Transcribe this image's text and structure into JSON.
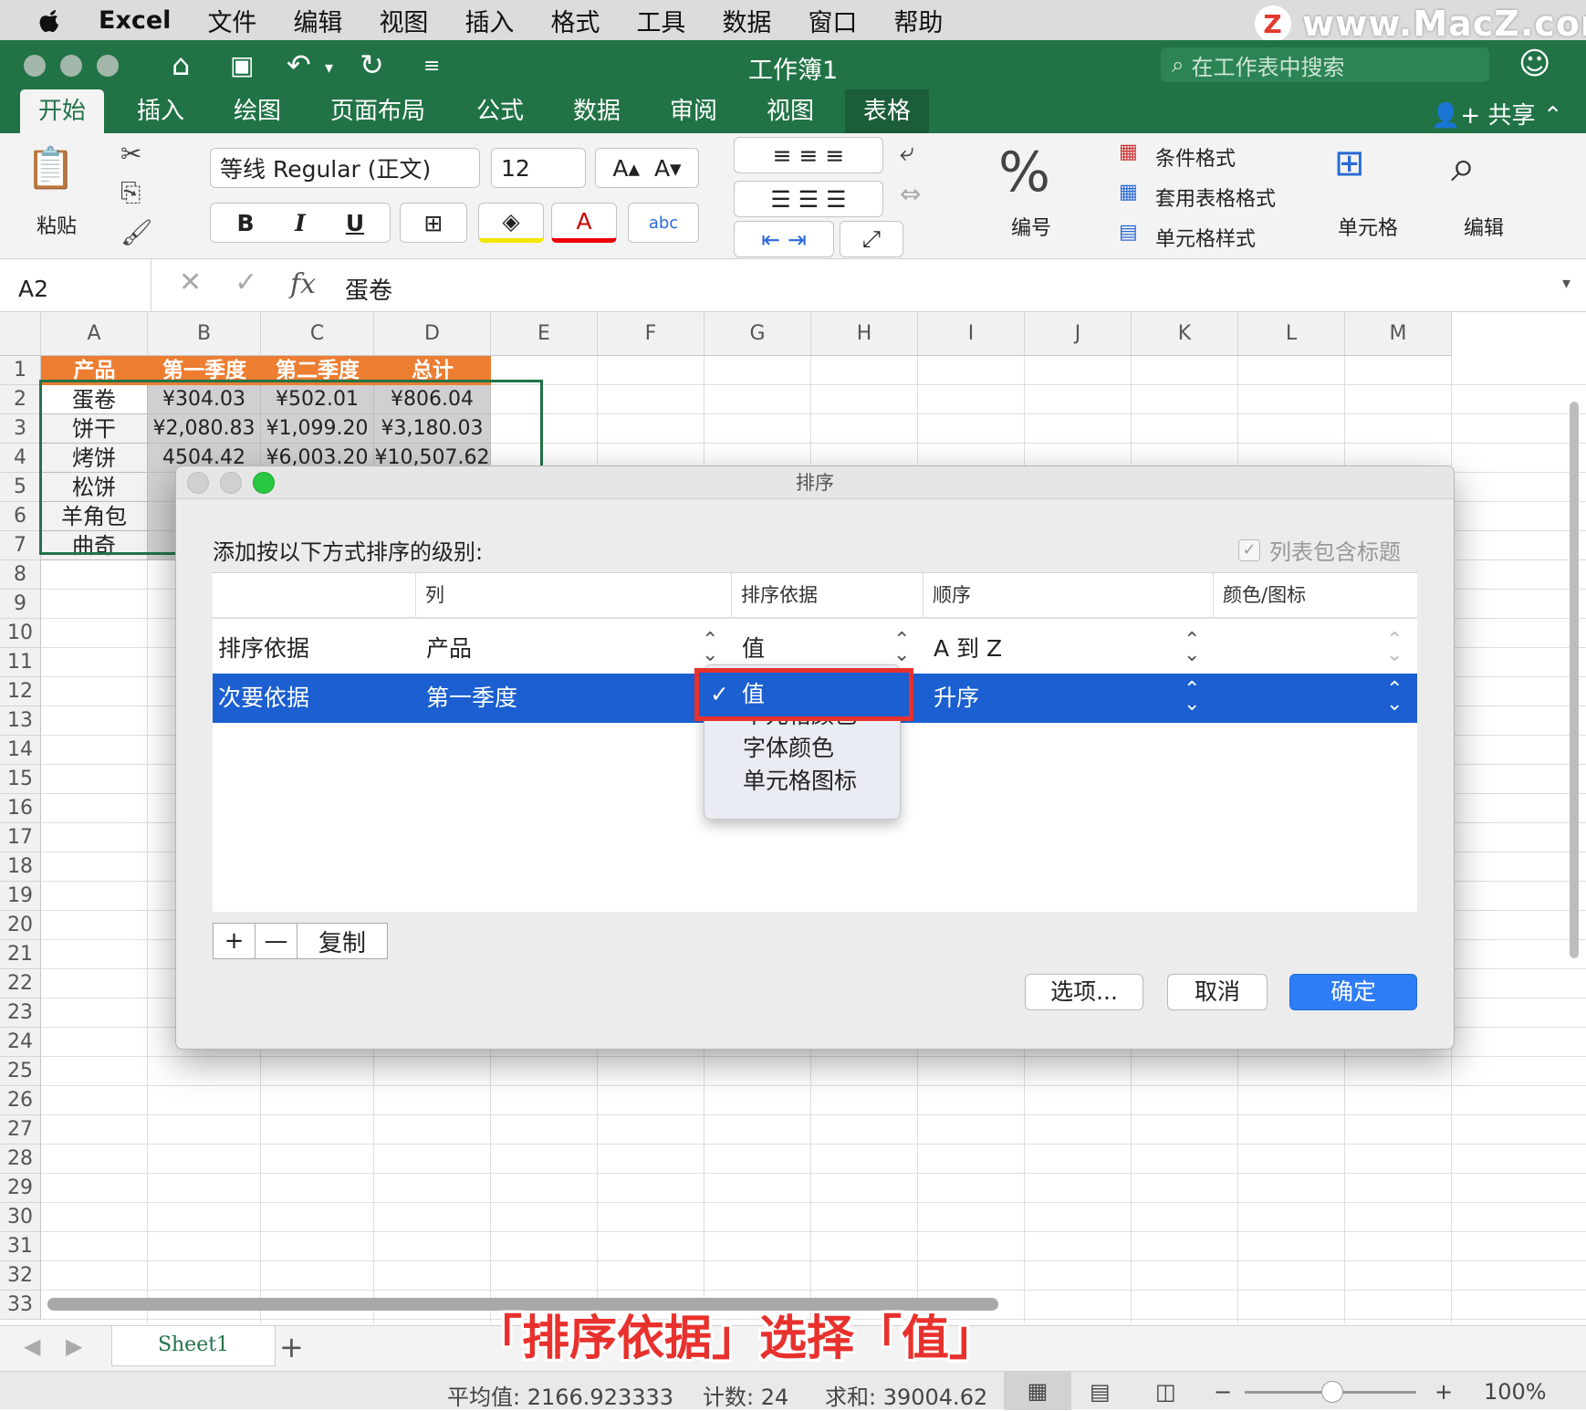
{
  "menubar": {
    "app": "Excel",
    "items": [
      "文件",
      "编辑",
      "视图",
      "插入",
      "格式",
      "工具",
      "数据",
      "窗口",
      "帮助"
    ]
  },
  "watermark": "www.MacZ.com",
  "titlebar": {
    "title": "工作簿1",
    "search_placeholder": "在工作表中搜索"
  },
  "tabs": [
    "开始",
    "插入",
    "绘图",
    "页面布局",
    "公式",
    "数据",
    "审阅",
    "视图",
    "表格"
  ],
  "share": "共享",
  "ribbon": {
    "paste": "粘贴",
    "font_name": "等线 Regular (正文)",
    "font_size": "12",
    "bold": "B",
    "italic": "I",
    "underline": "U",
    "number_label": "编号",
    "cond_format": "条件格式",
    "table_format": "套用表格格式",
    "cell_styles": "单元格样式",
    "cells_label": "单元格",
    "edit_label": "编辑"
  },
  "formula": {
    "name_box": "A2",
    "fx": "fx",
    "value": "蛋卷"
  },
  "grid": {
    "columns": [
      "A",
      "B",
      "C",
      "D",
      "E",
      "F",
      "G",
      "H",
      "I",
      "J",
      "K",
      "L",
      "M"
    ],
    "rows": [
      "1",
      "2",
      "3",
      "4",
      "5",
      "6",
      "7",
      "8",
      "9",
      "10",
      "11",
      "12",
      "13",
      "14",
      "15",
      "16",
      "17",
      "18",
      "19",
      "20",
      "21",
      "22",
      "23",
      "24",
      "25",
      "26",
      "27",
      "28",
      "29",
      "30",
      "31",
      "32",
      "33"
    ],
    "header": [
      "产品",
      "第一季度",
      "第二季度",
      "总计"
    ],
    "data": [
      [
        "蛋卷",
        "¥304.03",
        "¥502.01",
        "¥806.04"
      ],
      [
        "饼干",
        "¥2,080.83",
        "¥1,099.20",
        "¥3,180.03"
      ],
      [
        "烤饼",
        "4504.42",
        "¥6,003.20",
        "¥10,507.62"
      ],
      [
        "松饼",
        "",
        "",
        ""
      ],
      [
        "羊角包",
        "",
        "",
        ""
      ],
      [
        "曲奇",
        "",
        "",
        ""
      ]
    ]
  },
  "sheet": {
    "name": "Sheet1",
    "add": "+"
  },
  "caption": "「排序依据」选择「值」",
  "status": {
    "average": "平均值: 2166.923333",
    "count": "计数: 24",
    "sum": "求和: 39004.62",
    "zoom": "100%"
  },
  "dialog": {
    "title": "排序",
    "prompt": "添加按以下方式排序的级别:",
    "has_header": "列表包含标题",
    "columns": [
      "列",
      "排序依据",
      "顺序",
      "颜色/图标"
    ],
    "rows": [
      {
        "level": "排序依据",
        "column": "产品",
        "sort_on": "值",
        "order": "A 到 Z",
        "color": ""
      },
      {
        "level": "次要依据",
        "column": "第一季度",
        "sort_on": "值",
        "order": "升序",
        "color": ""
      }
    ],
    "popup": {
      "checked": "值",
      "items": [
        "值",
        "单元格颜色",
        "字体颜色",
        "单元格图标"
      ]
    },
    "add": "+",
    "remove": "—",
    "copy": "复制",
    "options": "选项...",
    "cancel": "取消",
    "ok": "确定"
  }
}
